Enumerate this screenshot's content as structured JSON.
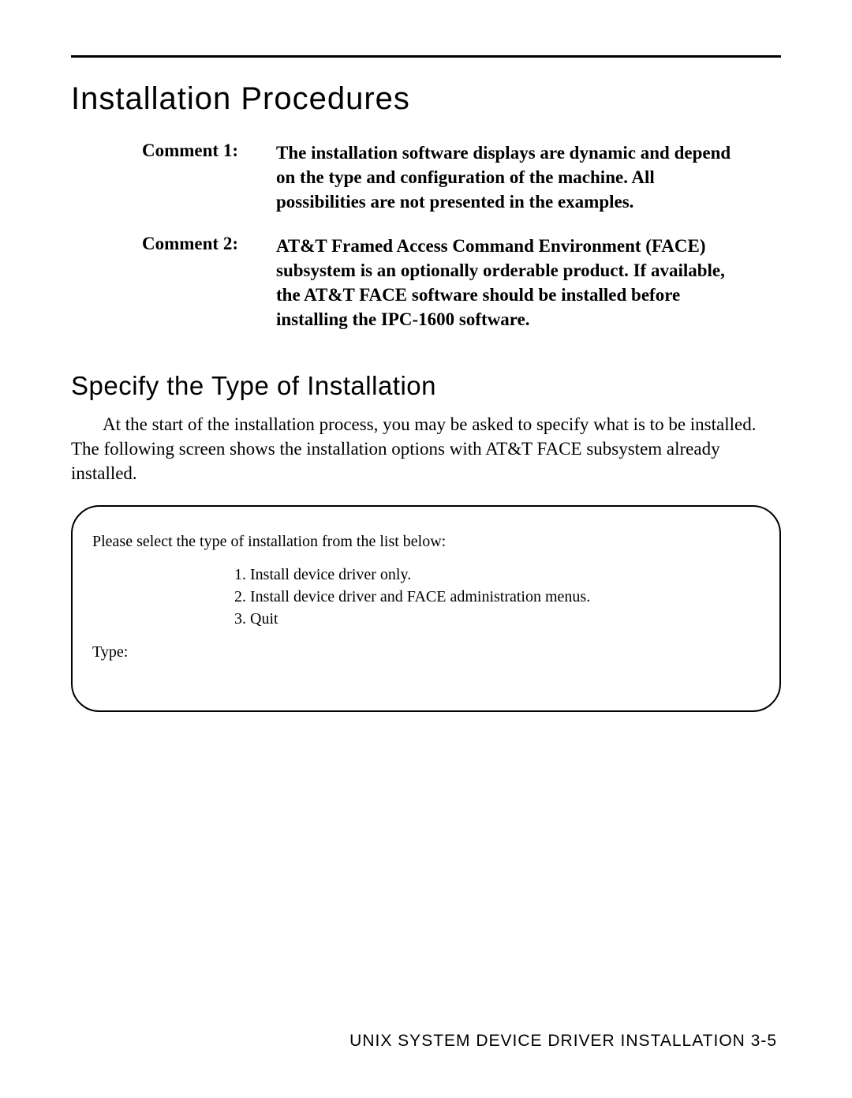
{
  "main_title": "Installation Procedures",
  "comments": [
    {
      "label": "Comment 1:",
      "text": "The installation software displays are dynamic and depend on the type and configuration of the machine. All possibilities are not presented in the examples."
    },
    {
      "label": "Comment 2:",
      "text": "AT&T Framed Access Command Environment (FACE) subsystem is an optionally orderable product. If available, the AT&T FACE software should be installed before installing the IPC-1600 software."
    }
  ],
  "section_title": "Specify the Type of Installation",
  "body_para": "At the start of the installation process, you may be asked to specify what is to be installed. The following screen shows the installation options with AT&T FACE subsystem already installed.",
  "terminal": {
    "prompt": "Please select the type of installation from the list below:",
    "options": [
      "1. Install device driver only.",
      "2. Install device driver and FACE administration menus.",
      "3. Quit"
    ],
    "type_label": "Type:"
  },
  "footer": "UNIX SYSTEM DEVICE DRIVER INSTALLATION  3-5"
}
